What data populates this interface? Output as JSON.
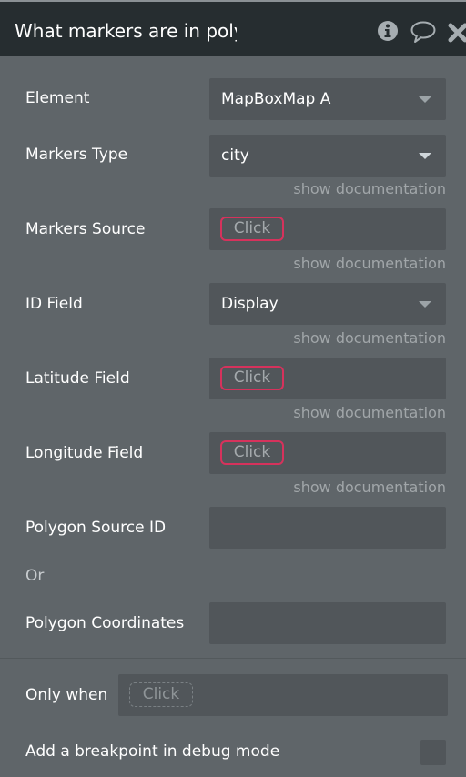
{
  "header": {
    "title": "What markers are in poly",
    "icons": [
      "info-icon",
      "comment-icon",
      "close-icon"
    ]
  },
  "fields": {
    "element": {
      "label": "Element",
      "value": "MapBoxMap A"
    },
    "markers_type": {
      "label": "Markers Type",
      "value": "city",
      "doc": "show documentation"
    },
    "markers_source": {
      "label": "Markers Source",
      "placeholder": "Click",
      "doc": "show documentation"
    },
    "id_field": {
      "label": "ID Field",
      "value": "Display",
      "doc": "show documentation"
    },
    "latitude_field": {
      "label": "Latitude Field",
      "placeholder": "Click",
      "doc": "show documentation"
    },
    "longitude_field": {
      "label": "Longitude Field",
      "placeholder": "Click",
      "doc": "show documentation"
    },
    "polygon_source_id": {
      "label": "Polygon Source ID",
      "value": ""
    },
    "or_text": "Or",
    "polygon_coordinates": {
      "label": "Polygon Coordinates",
      "value": ""
    }
  },
  "footer": {
    "only_when": {
      "label": "Only when",
      "placeholder": "Click"
    },
    "breakpoint": {
      "label": "Add a breakpoint in debug mode",
      "checked": false
    }
  },
  "colors": {
    "accent_required": "#d6325c",
    "header_bg": "#262d30",
    "panel_bg": "#5f6569",
    "field_bg": "#51565a"
  }
}
